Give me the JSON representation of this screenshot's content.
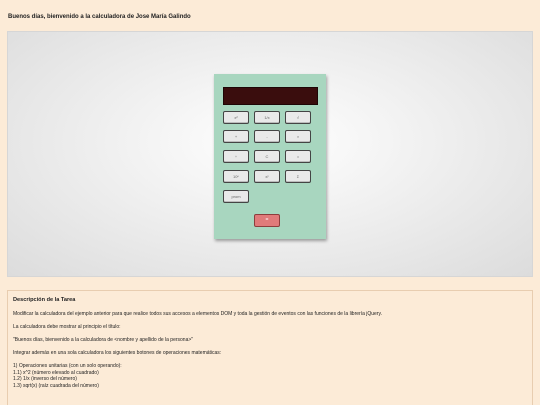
{
  "greeting": "Buenos días, bienvenido a la calculadora de Jose María Galindo",
  "calculator": {
    "display_value": "",
    "keys": [
      {
        "label": "x²"
      },
      {
        "label": "1/x"
      },
      {
        "label": "√"
      },
      {
        "label": "+"
      },
      {
        "label": "-"
      },
      {
        "label": "×"
      },
      {
        "label": "÷"
      },
      {
        "label": "C"
      },
      {
        "label": "="
      },
      {
        "label": "10ⁿ"
      },
      {
        "label": "xʸ"
      },
      {
        "label": "Σ"
      },
      {
        "label": "prom"
      }
    ],
    "equals_label": "="
  },
  "task": {
    "title": "Descripción de la Tarea",
    "p1": "Modificar la calculadora del ejemplo anterior para que realice todos sus accesos a elementos DOM y toda la gestión de eventos con las funciones de la librería jQuery.",
    "p2": "La calculadora debe mostrar al principio el título:",
    "p3": "\"Buenos días, bienvenido a la calculadora de <nombre y apellido de la persona>\"",
    "p4": "Integrar además en una sola calculadora los siguientes botones de operaciones matemáticas:",
    "ops_heading": "1) Operaciones unitarias (con un solo operando):",
    "op1": "1.1) x^2 (número elevado al cuadrado)",
    "op2": "1.2) 1/x (inverso del número)",
    "op3": "1.3) sqrt(x) (raíz cuadrada del número)"
  }
}
